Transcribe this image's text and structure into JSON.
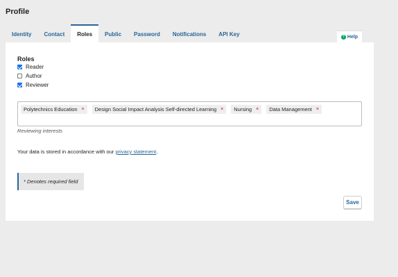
{
  "page": {
    "title": "Profile"
  },
  "tabs": [
    {
      "label": "Identity"
    },
    {
      "label": "Contact"
    },
    {
      "label": "Roles"
    },
    {
      "label": "Public"
    },
    {
      "label": "Password"
    },
    {
      "label": "Notifications"
    },
    {
      "label": "API Key"
    }
  ],
  "active_tab": "Roles",
  "help": {
    "label": "Help",
    "icon": "help-circle-icon",
    "icon_color": "#00a65a"
  },
  "roles": {
    "heading": "Roles",
    "items": [
      {
        "label": "Reader",
        "checked": true
      },
      {
        "label": "Author",
        "checked": false
      },
      {
        "label": "Reviewer",
        "checked": true
      }
    ]
  },
  "interests": {
    "tags": [
      {
        "label": "Polytechnics Education",
        "remove": "×"
      },
      {
        "label": "Design Social Impact Analysis Self-directed Learning",
        "remove": "×"
      },
      {
        "label": "Nursing",
        "remove": "×"
      },
      {
        "label": "Data Management",
        "remove": "×"
      }
    ],
    "hint": "Reviewing interests"
  },
  "privacy": {
    "prefix": "Your data is stored in accordance with our ",
    "link_text": "privacy statement",
    "suffix": "."
  },
  "required_note": "* Denotes required field",
  "save_label": "Save",
  "colors": {
    "link": "#2a6496",
    "checkbox": "#1a73e8",
    "remove_x": "#cc0000",
    "background": "#ececec"
  }
}
